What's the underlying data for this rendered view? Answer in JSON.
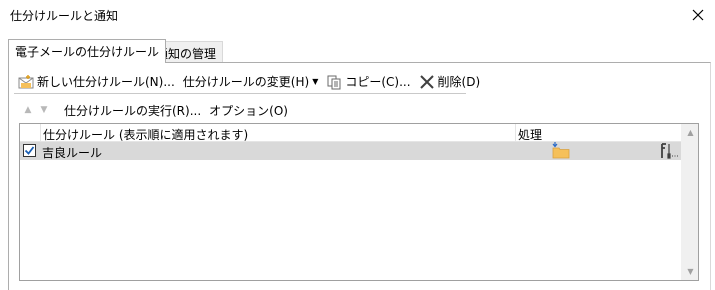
{
  "window": {
    "title": "仕分けルールと通知"
  },
  "tabs": [
    {
      "label": "電子メールの仕分けルール"
    },
    {
      "label": "通知の管理"
    }
  ],
  "toolbar": {
    "new_rule": "新しい仕分けルール(N)...",
    "change_rule": "仕分けルールの変更(H)",
    "copy": "コピー(C)...",
    "delete": "削除(D)"
  },
  "toolbar2": {
    "run_rules": "仕分けルールの実行(R)...",
    "options": "オプション(O)"
  },
  "list": {
    "headers": {
      "rule": "仕分けルール (表示順に適用されます)",
      "action": "処理"
    },
    "rows": [
      {
        "label": "吉良ルール",
        "checked": true
      }
    ]
  },
  "icons": {
    "close": "close-icon",
    "new_rule": "new-rule-icon",
    "copy": "copy-icon",
    "delete": "delete-icon",
    "move_up": "move-up-icon",
    "move_down": "move-down-icon",
    "folder": "move-to-folder-icon",
    "tools": "rule-options-icon"
  },
  "colors": {
    "selected_row": "#d9d9d9",
    "folder": "#f5c05a",
    "check": "#1a5fb4"
  }
}
